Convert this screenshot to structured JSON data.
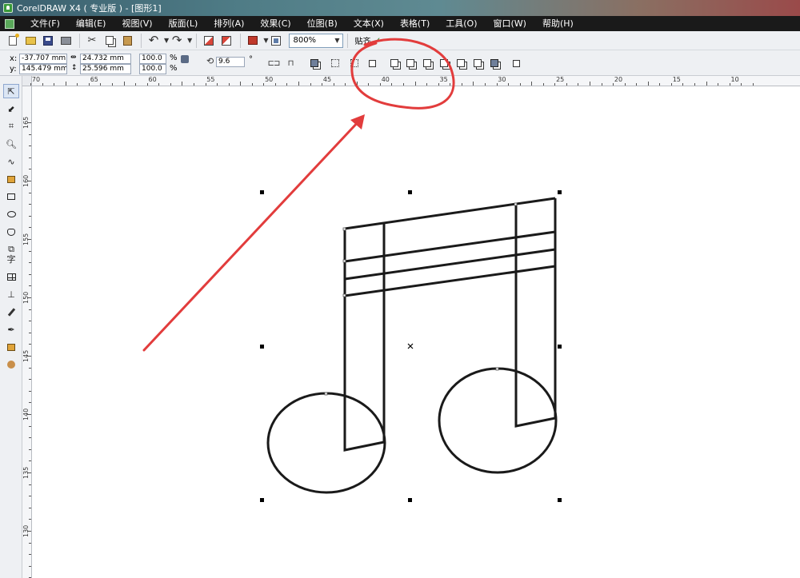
{
  "window": {
    "title": "CorelDRAW X4 ( 专业版 ) - [图形1]"
  },
  "menu": {
    "items": [
      {
        "label": "文件(F)"
      },
      {
        "label": "编辑(E)"
      },
      {
        "label": "视图(V)"
      },
      {
        "label": "版面(L)"
      },
      {
        "label": "排列(A)"
      },
      {
        "label": "效果(C)"
      },
      {
        "label": "位图(B)"
      },
      {
        "label": "文本(X)"
      },
      {
        "label": "表格(T)"
      },
      {
        "label": "工具(O)"
      },
      {
        "label": "窗口(W)"
      },
      {
        "label": "帮助(H)"
      }
    ]
  },
  "toolbar": {
    "zoom": "800%",
    "snap_label": "贴齐"
  },
  "properties": {
    "x_label": "x:",
    "y_label": "y:",
    "x_value": "-37.707 mm",
    "y_value": "145.479 mm",
    "width_value": "24.732 mm",
    "height_value": "25.596 mm",
    "scale_x": "100.0",
    "scale_y": "100.0",
    "percent": "%",
    "rotation": "9.6",
    "degree": "°"
  },
  "ruler": {
    "horizontal": [
      "70",
      "65",
      "60",
      "55",
      "50",
      "45",
      "40",
      "35",
      "30",
      "25",
      "20",
      "15",
      "10"
    ],
    "vertical": [
      "165",
      "160",
      "155",
      "150",
      "145",
      "140",
      "135",
      "130"
    ]
  },
  "tools": [
    {
      "name": "pick-tool",
      "glyph": "arrow"
    },
    {
      "name": "shape-tool",
      "glyph": "shape"
    },
    {
      "name": "crop-tool",
      "glyph": "crop"
    },
    {
      "name": "zoom-tool",
      "glyph": "zoom"
    },
    {
      "name": "freehand-tool",
      "glyph": "freehand"
    },
    {
      "name": "smart-fill-tool",
      "glyph": "smart-fill"
    },
    {
      "name": "rectangle-tool",
      "glyph": "rectangle"
    },
    {
      "name": "ellipse-tool",
      "glyph": "ellipse"
    },
    {
      "name": "polygon-tool",
      "glyph": "polygon"
    },
    {
      "name": "basic-shapes-tool",
      "glyph": "basic-shapes"
    },
    {
      "name": "text-tool",
      "glyph": "字"
    },
    {
      "name": "table-tool",
      "glyph": "table"
    },
    {
      "name": "dimension-tool",
      "glyph": "dimension"
    },
    {
      "name": "eyedropper-tool",
      "glyph": "eyedropper"
    },
    {
      "name": "outline-tool",
      "glyph": "outline"
    },
    {
      "name": "fill-tool",
      "glyph": "fill"
    },
    {
      "name": "interactive-fill-tool",
      "glyph": "interactive-fill"
    }
  ],
  "colors": {
    "annotation": "#e23c3c",
    "stroke": "#1a1a1a",
    "menubar": "#1a1a1a"
  }
}
